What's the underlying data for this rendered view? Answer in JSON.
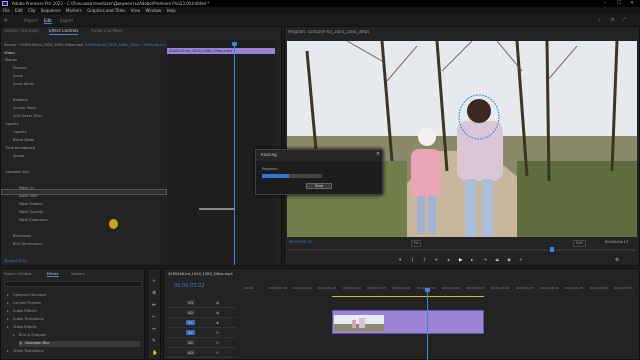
{
  "app": {
    "title": "Adobe Premiere Pro 2023 - C:\\Пользователи\\User\\Документы\\Adobe\\Premiere Pro\\23.0\\Untitled *",
    "window_controls": [
      "–",
      "☐",
      "✕"
    ]
  },
  "menu": [
    "File",
    "Edit",
    "Clip",
    "Sequence",
    "Markers",
    "Graphics and Titles",
    "View",
    "Window",
    "Help"
  ],
  "workspace_tabs": [
    "Import",
    "Edit",
    "Export"
  ],
  "effect_controls": {
    "tabs": [
      "Source: (no clips)",
      "Effect Controls",
      "Audio Clip Mixer"
    ],
    "source_path": "Source • 4265246-hd_1920_1080_30fps.mp4",
    "clip_path": "4265246-hd_1920_1080_30fps • 4265246-hd...",
    "timeline_clip_label": "4265246-hd_1920_1080_30fps.mp4",
    "section_video": "Video",
    "rows": [
      {
        "label": "Motion",
        "value": ""
      },
      {
        "label": "Position",
        "value": "960.0   540.0"
      },
      {
        "label": "Scale",
        "value": "100.0"
      },
      {
        "label": "Scale Width",
        "value": "100.0"
      },
      {
        "label": "",
        "value": "✓ Uniform Scale"
      },
      {
        "label": "Rotation",
        "value": "0.0"
      },
      {
        "label": "Anchor Point",
        "value": "960.0   540.0"
      },
      {
        "label": "Anti-flicker Filter",
        "value": "0.00"
      },
      {
        "label": "Opacity",
        "value": ""
      },
      {
        "label": "Opacity",
        "value": "100.0 %"
      },
      {
        "label": "Blend Mode",
        "value": "Normal"
      },
      {
        "label": "Time Remapping",
        "value": ""
      },
      {
        "label": "Speed",
        "value": "100.00%"
      },
      {
        "label": "",
        "value": "Vertical Motion Contest"
      },
      {
        "label": "Gaussian Blur",
        "value": ""
      },
      {
        "label": "",
        "value": ""
      },
      {
        "label": "Mask (1)",
        "value": ""
      },
      {
        "label": "Mask Path",
        "value": "◂ ◆ ▸"
      },
      {
        "label": "Mask Feather",
        "value": "10.0"
      },
      {
        "label": "Mask Opacity",
        "value": "100.0 %"
      },
      {
        "label": "Mask Expansion",
        "value": "0.0"
      },
      {
        "label": "",
        "value": "Inverted"
      },
      {
        "label": "Blurriness",
        "value": "25.0"
      },
      {
        "label": "Blur Dimensions",
        "value": "Horizontal and Vertical"
      },
      {
        "label": "",
        "value": "Repeat Edge Pixels"
      }
    ],
    "timecode": "00:00:03:22"
  },
  "program_monitor": {
    "title": "Program: 4265246-hd_1920_1080_30fps",
    "timecode_left": "00:00:01:21",
    "fit": "Fit",
    "quality": "Full",
    "timecode_right": "00:00:04:17"
  },
  "tracking_dialog": {
    "title": "Tracking",
    "progress_label": "Progress:",
    "progress": 0.45,
    "stop_label": "Stop"
  },
  "project": {
    "tabs": [
      "Project: Untitled",
      "Media Browser",
      "Libraries",
      "Info",
      "Effects",
      "Markers",
      "History"
    ],
    "items": [
      {
        "label": "Optimum Versions",
        "selected": false
      },
      {
        "label": "Lumetri Presets",
        "selected": false
      },
      {
        "label": "Audio Effects",
        "selected": false
      },
      {
        "label": "Audio Transitions",
        "selected": false
      },
      {
        "label": "Video Effects",
        "selected": false
      },
      {
        "label": "Blur & Sharpen",
        "selected": false
      },
      {
        "label": "Gaussian Blur",
        "selected": true
      },
      {
        "label": "Video Transitions",
        "selected": false
      }
    ]
  },
  "timeline": {
    "title": "4265246-hd_1920_1080_30fps.mp4",
    "timecode": "00:00:03:22",
    "ruler": [
      "00:00",
      "00:00:00:15",
      "00:00:01:00",
      "00:00:01:15",
      "00:00:02:00",
      "00:00:02:15",
      "00:00:03:00",
      "00:00:03:15",
      "00:00:04:00",
      "00:00:04:15",
      "00:00:05:00",
      "00:00:05:15",
      "00:00:06:00",
      "00:00:06:15",
      "00:00:07:00",
      "00:00:07:15"
    ],
    "tracks": [
      "V3",
      "V2",
      "V1",
      "A1",
      "A2",
      "A3"
    ],
    "clip_label": "4265246-hd_1920_1080_30fps.mp4 [V]"
  },
  "colors": {
    "accent": "#3b86e0",
    "clip": "#9b84d4",
    "panel": "#232323",
    "background": "#1b1b1b"
  }
}
